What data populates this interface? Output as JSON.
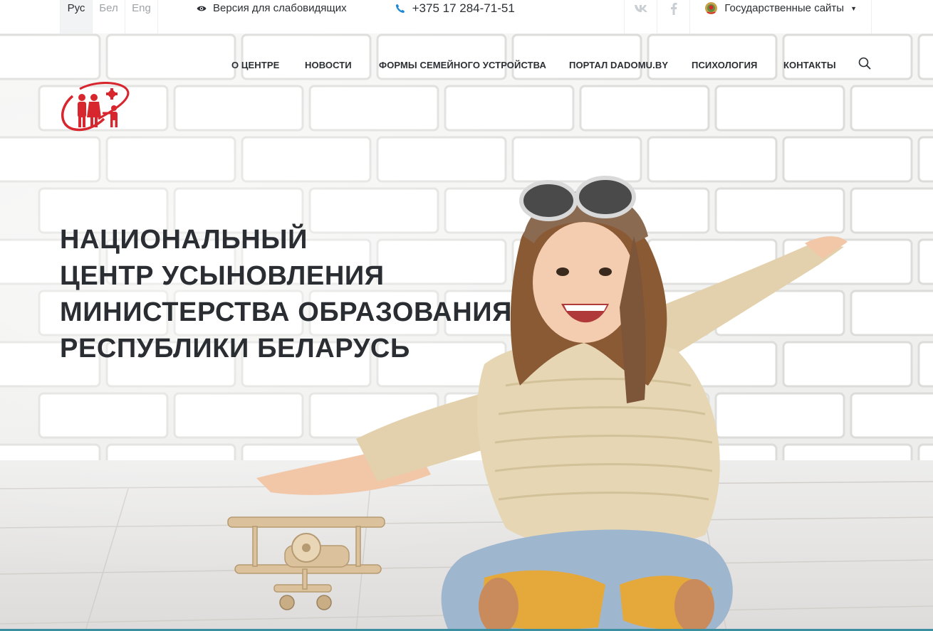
{
  "topbar": {
    "languages": [
      {
        "label": "Рус",
        "active": true
      },
      {
        "label": "Бел",
        "active": false
      },
      {
        "label": "Eng",
        "active": false
      }
    ],
    "vision_label": "Версия для слабовидящих",
    "vision_icon": "eye-icon",
    "phone": "+375 17 284-71-51",
    "phone_icon": "phone-icon",
    "social": [
      {
        "name": "vk-icon"
      },
      {
        "name": "facebook-icon"
      }
    ],
    "gov_sites_label": "Государственные сайты",
    "gov_icon": "emblem-icon"
  },
  "nav": {
    "items": [
      {
        "label": "О ЦЕНТРЕ"
      },
      {
        "label": "НОВОСТИ"
      },
      {
        "label": "ФОРМЫ СЕМЕЙНОГО УСТРОЙСТВА"
      },
      {
        "label": "ПОРТАЛ DADOMU.BY"
      },
      {
        "label": "ПСИХОЛОГИЯ"
      },
      {
        "label": "КОНТАКТЫ"
      }
    ],
    "search_icon": "search-icon"
  },
  "hero": {
    "title_lines": [
      "НАЦИОНАЛЬНЫЙ",
      "ЦЕНТР УСЫНОВЛЕНИЯ",
      "МИНИСТЕРСТВА ОБРАЗОВАНИЯ",
      "РЕСПУБЛИКИ БЕЛАРУСЬ"
    ]
  },
  "colors": {
    "brand_red": "#d7262e",
    "phone_blue": "#1e88d6",
    "text_dark": "#2b2f33",
    "muted": "#a0a4a8"
  }
}
